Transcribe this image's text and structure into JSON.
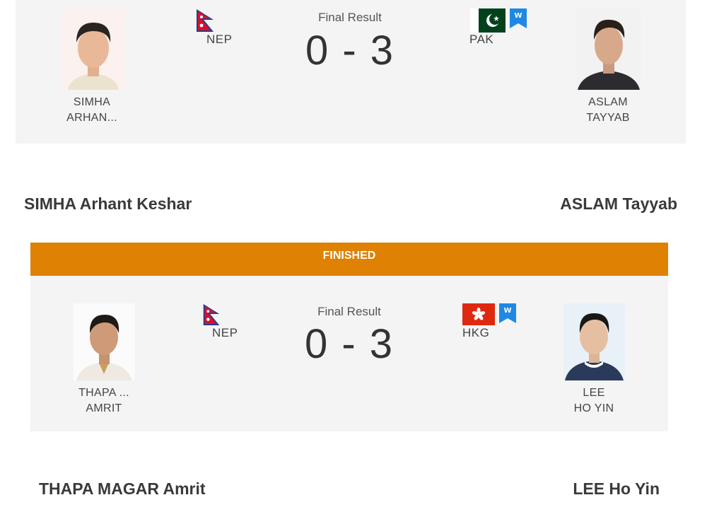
{
  "match1": {
    "home": {
      "short_line1": "SIMHA",
      "short_line2": "ARHAN...",
      "country_code": "NEP",
      "full_name": "SIMHA Arhant Keshar"
    },
    "result_label": "Final Result",
    "score": "0 - 3",
    "away": {
      "short_line1": "ASLAM",
      "short_line2": "TAYYAB",
      "country_code": "PAK",
      "full_name": "ASLAM Tayyab",
      "winner_badge": "W"
    }
  },
  "match2": {
    "status": "FINISHED",
    "home": {
      "short_line1": "THAPA ...",
      "short_line2": "AMRIT",
      "country_code": "NEP",
      "full_name": "THAPA MAGAR Amrit"
    },
    "result_label": "Final Result",
    "score": "0 - 3",
    "away": {
      "short_line1": "LEE",
      "short_line2": "HO YIN",
      "country_code": "HKG",
      "full_name": "LEE Ho Yin",
      "winner_badge": "W"
    }
  },
  "colors": {
    "status_bar": "#df8103",
    "card_bg": "#f4f4f4",
    "winner_badge": "#1e88e5"
  },
  "icons": [
    "nepal-flag-icon",
    "pakistan-flag-icon",
    "hong-kong-flag-icon",
    "winner-badge-icon"
  ]
}
